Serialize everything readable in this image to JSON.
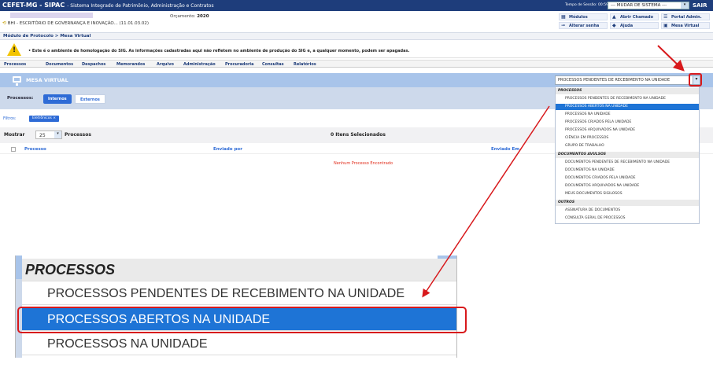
{
  "header": {
    "system_name": "CEFET-MG - SIPAC",
    "system_subtitle": "- Sistema Integrado de Patrimônio, Administração e Contratos",
    "session_label": "Tempo de Sessão: 00:59",
    "change_system": "--- MUDAR DE SISTEMA ---",
    "logout": "SAIR"
  },
  "info": {
    "budget_label": "Orçamento:",
    "budget_year": "2020",
    "unit": "BHI - ESCRITÓRIO DE GOVERNANÇA E INOVAÇÃO... (11.01.03.02)"
  },
  "quick_links": [
    {
      "label": "Módulos",
      "icon": "grid-icon"
    },
    {
      "label": "Abrir Chamado",
      "icon": "warning-icon"
    },
    {
      "label": "Portal Admin.",
      "icon": "list-icon"
    },
    {
      "label": "Alterar senha",
      "icon": "key-icon"
    },
    {
      "label": "Ajuda",
      "icon": "help-icon"
    },
    {
      "label": "Mesa Virtual",
      "icon": "desk-icon"
    }
  ],
  "breadcrumb": "Módulo de Protocolo > Mesa Virtual",
  "warning": "• Este é o ambiente de homologação do SIG. As informações cadastradas aqui não refletem no ambiente de produção do SIG e, a qualquer momento, podem ser apagadas.",
  "menu": [
    "Processos",
    "Documentos",
    "Despachos",
    "Memorandos",
    "Arquivo",
    "Administração",
    "Procuradoria",
    "Consultas",
    "Relatórios"
  ],
  "mesa": {
    "title": "MESA VIRTUAL",
    "select_value": "PROCESSOS PENDENTES DE RECEBIMENTO NA UNIDADE"
  },
  "processos": {
    "label": "Processos:",
    "tab_internal": "Internos",
    "tab_external": "Externos"
  },
  "filters": {
    "label": "Filtros:",
    "chip": "Eletrônicos"
  },
  "table": {
    "show_label": "Mostrar",
    "page_size": "25",
    "show_suffix": "Processos",
    "selected": "0 Itens Selecionados",
    "headers": [
      "Processo",
      "Enviado por",
      "Enviado Em"
    ],
    "empty": "Nenhum Processo Encontrado"
  },
  "dropdown": [
    {
      "label": "PROCESSOS",
      "group": true
    },
    {
      "label": "PROCESSOS PENDENTES DE RECEBIMENTO NA UNIDADE"
    },
    {
      "label": "PROCESSOS ABERTOS NA UNIDADE",
      "selected": true
    },
    {
      "label": "PROCESSOS NA UNIDADE"
    },
    {
      "label": "PROCESSOS CRIADOS PELA UNIDADE"
    },
    {
      "label": "PROCESSOS ARQUIVADOS NA UNIDADE"
    },
    {
      "label": "CIÊNCIA EM PROCESSOS"
    },
    {
      "label": "GRUPO DE TRABALHO"
    },
    {
      "label": "DOCUMENTOS AVULSOS",
      "group": true
    },
    {
      "label": "DOCUMENTOS PENDENTES DE RECEBIMENTO NA UNIDADE"
    },
    {
      "label": "DOCUMENTOS NA UNIDADE"
    },
    {
      "label": "DOCUMENTOS CRIADOS PELA UNIDADE"
    },
    {
      "label": "DOCUMENTOS ARQUIVADOS NA UNIDADE"
    },
    {
      "label": "MEUS DOCUMENTOS SIGILOSOS"
    },
    {
      "label": "OUTROS",
      "group": true
    },
    {
      "label": "ASSINATURA DE DOCUMENTOS"
    },
    {
      "label": "CONSULTA GERAL DE PROCESSOS"
    }
  ],
  "zoom": [
    {
      "label": "PROCESSOS",
      "group": true
    },
    {
      "label": "PROCESSOS PENDENTES DE RECEBIMENTO NA UNIDADE"
    },
    {
      "label": "PROCESSOS ABERTOS NA UNIDADE",
      "selected": true
    },
    {
      "label": "PROCESSOS NA UNIDADE"
    }
  ],
  "colors": {
    "header_bg": "#1e3d7b",
    "mesa_bar": "#a8c4ea",
    "selection": "#1e74d6",
    "annotation_red": "#d8191c"
  }
}
